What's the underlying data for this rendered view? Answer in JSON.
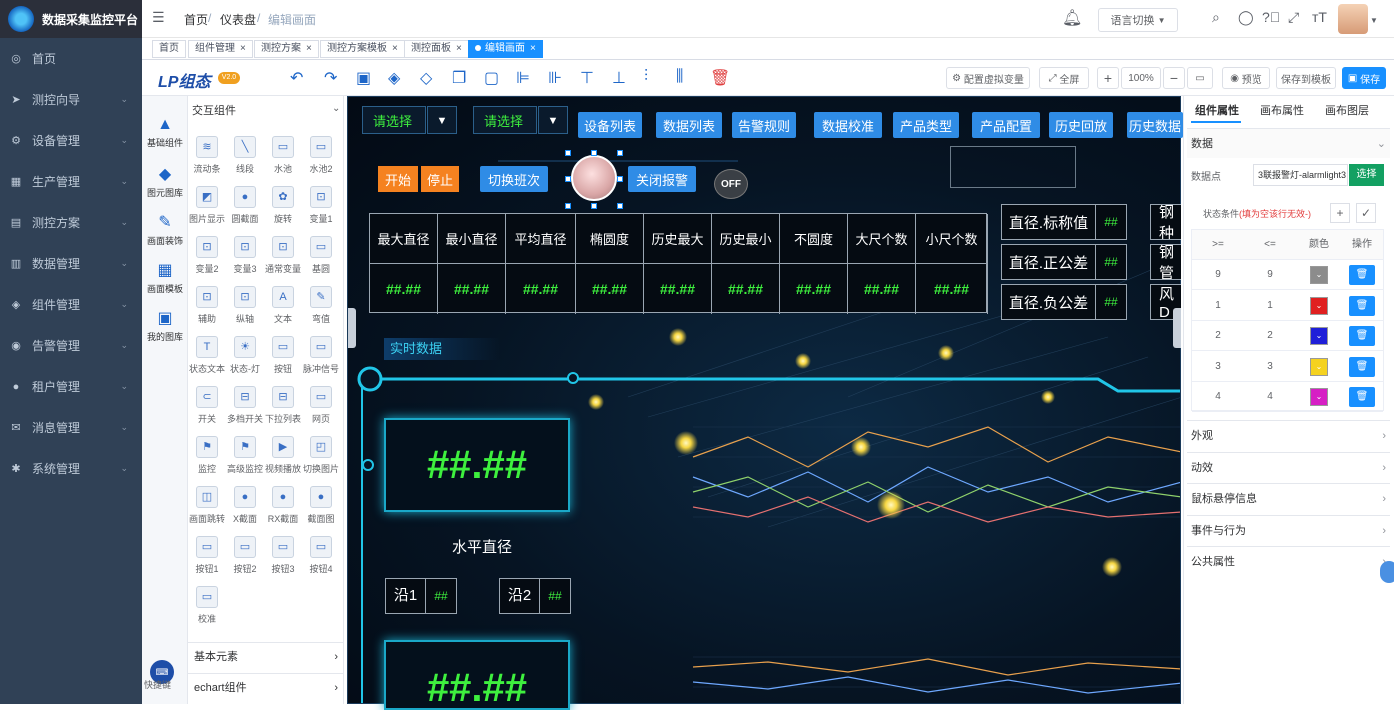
{
  "app": {
    "title": "数据采集监控平台"
  },
  "sidebar": {
    "items": [
      {
        "label": "首页",
        "icon": "dashboard-icon",
        "glyph": "◎",
        "chev": false
      },
      {
        "label": "测控向导",
        "icon": "send-icon",
        "glyph": "➤",
        "chev": true
      },
      {
        "label": "设备管理",
        "icon": "gear-icon",
        "glyph": "⚙",
        "chev": true
      },
      {
        "label": "生产管理",
        "icon": "list-icon",
        "glyph": "▦",
        "chev": true
      },
      {
        "label": "测控方案",
        "icon": "table-icon",
        "glyph": "▤",
        "chev": true
      },
      {
        "label": "数据管理",
        "icon": "chart-icon",
        "glyph": "▥",
        "chev": true
      },
      {
        "label": "组件管理",
        "icon": "component-icon",
        "glyph": "◈",
        "chev": true
      },
      {
        "label": "告警管理",
        "icon": "alert-icon",
        "glyph": "◉",
        "chev": true
      },
      {
        "label": "租户管理",
        "icon": "user-icon",
        "glyph": "●",
        "chev": true
      },
      {
        "label": "消息管理",
        "icon": "mail-icon",
        "glyph": "✉",
        "chev": true
      },
      {
        "label": "系统管理",
        "icon": "settings-icon",
        "glyph": "✱",
        "chev": true
      }
    ]
  },
  "header": {
    "breadcrumb": [
      "首页",
      "仪表盘",
      "编辑画面"
    ],
    "lang": "语言切换"
  },
  "tabs": [
    "首页",
    "组件管理",
    "测控方案",
    "测控方案模板",
    "测控面板",
    "编辑画面"
  ],
  "toolbar": {
    "brand": "LP组态",
    "badge": "V2.0",
    "virtual_var": "配置虚拟变量",
    "fullscreen": "全屏",
    "zoom": "100%",
    "preview": "预览",
    "save_template": "保存到模板",
    "save": "保存"
  },
  "library": {
    "tabs": [
      "基础组件",
      "图元图库",
      "画面装饰",
      "画面模板",
      "我的图库"
    ],
    "section": "交互组件",
    "components": [
      "流动条",
      "线段",
      "水池",
      "水池2",
      "图片显示",
      "圆截面",
      "旋转",
      "变量1",
      "变量2",
      "变量3",
      "通常变量",
      "基圆",
      "辅助",
      "纵轴",
      "文本",
      "弯值",
      "状态文本",
      "状态-灯",
      "按钮",
      "脉冲信号",
      "开关",
      "多档开关",
      "下拉列表",
      "网页",
      "监控",
      "高级监控",
      "视频播放",
      "切换图片",
      "画面跳转",
      "X截面",
      "RX截面",
      "截面图",
      "按钮1",
      "按钮2",
      "按钮3",
      "按钮4",
      "校准"
    ],
    "sections_bottom": [
      "基本元素",
      "echart组件"
    ],
    "quick": "快捷键"
  },
  "canvas": {
    "select1": "请选择",
    "select2": "请选择",
    "nav_buttons": [
      "设备列表",
      "数据列表",
      "告警规则",
      "数据校准",
      "产品类型",
      "产品配置",
      "历史回放",
      "历史数据"
    ],
    "start": "开始",
    "stop": "停止",
    "switch_shift": "切换班次",
    "close_alarm": "关闭报警",
    "off": "OFF",
    "stat_headers": [
      "最大直径",
      "最小直径",
      "平均直径",
      "椭圆度",
      "历史最大",
      "历史最小",
      "不圆度",
      "大尺个数",
      "小尺个数"
    ],
    "stat_values": [
      "##.##",
      "##.##",
      "##.##",
      "##.##",
      "##.##",
      "##.##",
      "##.##",
      "##.##",
      "##.##"
    ],
    "tolerances": [
      {
        "label": "直径.标称值",
        "value": "##"
      },
      {
        "label": "直径.正公差",
        "value": "##"
      },
      {
        "label": "直径.负公差",
        "value": "##"
      }
    ],
    "cut_labels": [
      "钢种",
      "钢管",
      "风D"
    ],
    "realtime": "实时数据",
    "big_value": "##.##",
    "big_label": "水平直径",
    "edges": [
      {
        "label": "沿1",
        "value": "##"
      },
      {
        "label": "沿2",
        "value": "##"
      }
    ],
    "big_value2": "##.##"
  },
  "props": {
    "tabs": [
      "组件属性",
      "画布属性",
      "画布图层"
    ],
    "section": "数据",
    "datapoint_label": "数据点",
    "datapoint_value": "3联报警灯-alarmlight3",
    "select_btn": "选择",
    "cond_label": "状态条件",
    "cond_hint": "(填为空该行无效-)",
    "table_headers": [
      ">=",
      "<=",
      "颜色",
      "操作"
    ],
    "rows": [
      {
        "ge": "9",
        "le": "9",
        "color": "#8c8c8c"
      },
      {
        "ge": "1",
        "le": "1",
        "color": "#e02020"
      },
      {
        "ge": "2",
        "le": "2",
        "color": "#1f1fd8"
      },
      {
        "ge": "3",
        "le": "3",
        "color": "#f5d21f"
      },
      {
        "ge": "4",
        "le": "4",
        "color": "#d61fc4"
      }
    ],
    "sections": [
      "外观",
      "动效",
      "鼠标悬停信息",
      "事件与行为",
      "公共属性"
    ]
  }
}
